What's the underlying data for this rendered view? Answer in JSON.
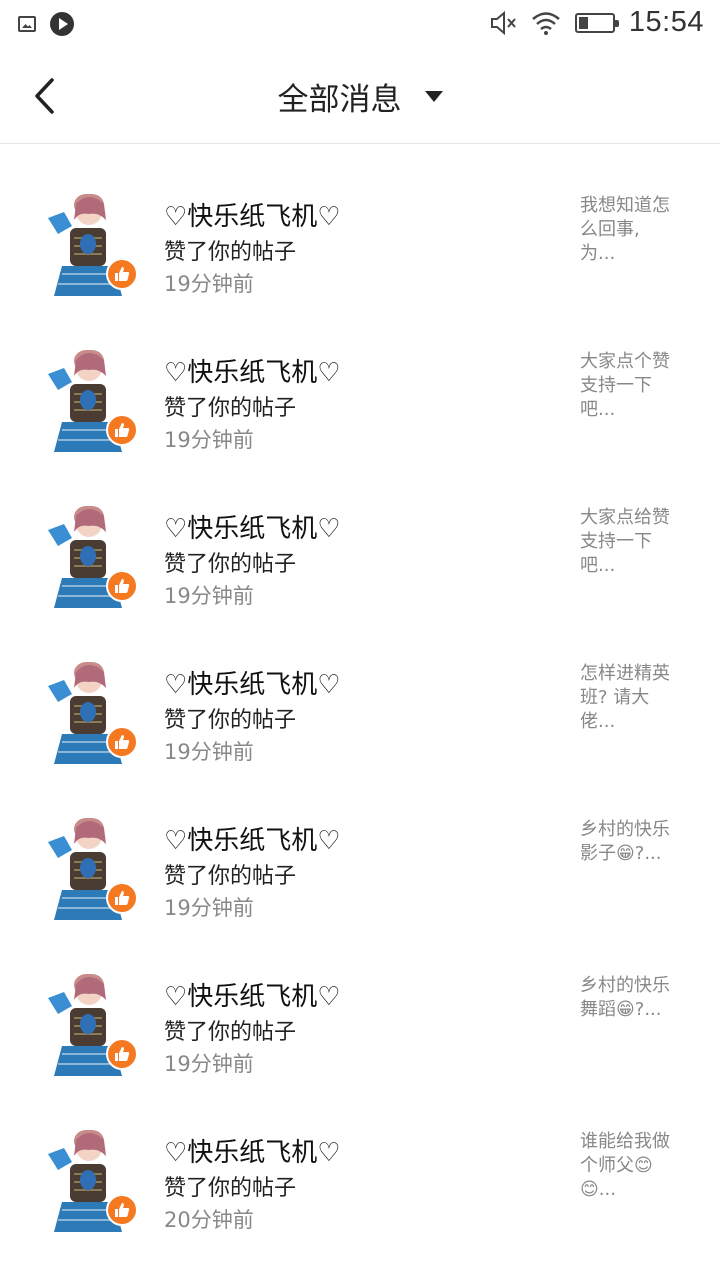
{
  "status_bar": {
    "time": "15:54",
    "icons": [
      "gallery-icon",
      "play-icon",
      "mute-icon",
      "wifi-icon",
      "battery-icon"
    ]
  },
  "header": {
    "title": "全部消息",
    "back_icon": "back-arrow-icon",
    "dropdown_icon": "caret-down-icon"
  },
  "colors": {
    "like_badge": "#f47920",
    "text_primary": "#222222",
    "text_secondary": "#888888",
    "divider": "#e5e5e5"
  },
  "notifications": [
    {
      "nickname": "♡快乐纸飞机♡",
      "action": "赞了你的帖子",
      "time": "19分钟前",
      "preview": ""
    },
    {
      "nickname": "♡快乐纸飞机♡",
      "action": "赞了你的帖子",
      "time": "19分钟前",
      "preview": "我想知道怎\n么回事,\n为..."
    },
    {
      "nickname": "♡快乐纸飞机♡",
      "action": "赞了你的帖子",
      "time": "19分钟前",
      "preview": "大家点个赞\n支持一下\n吧..."
    },
    {
      "nickname": "♡快乐纸飞机♡",
      "action": "赞了你的帖子",
      "time": "19分钟前",
      "preview": "大家点给赞\n支持一下\n吧..."
    },
    {
      "nickname": "♡快乐纸飞机♡",
      "action": "赞了你的帖子",
      "time": "19分钟前",
      "preview": "怎样进精英\n班? 请大\n佬..."
    },
    {
      "nickname": "♡快乐纸飞机♡",
      "action": "赞了你的帖子",
      "time": "19分钟前",
      "preview": "乡村的快乐\n影子😁?..."
    },
    {
      "nickname": "♡快乐纸飞机♡",
      "action": "赞了你的帖子",
      "time": "19分钟前",
      "preview": "乡村的快乐\n舞蹈😁?..."
    },
    {
      "nickname": "♡快乐纸飞机♡",
      "action": "赞了你的帖子",
      "time": "20分钟前",
      "preview": "谁能给我做\n个师父😊\n😊..."
    }
  ]
}
